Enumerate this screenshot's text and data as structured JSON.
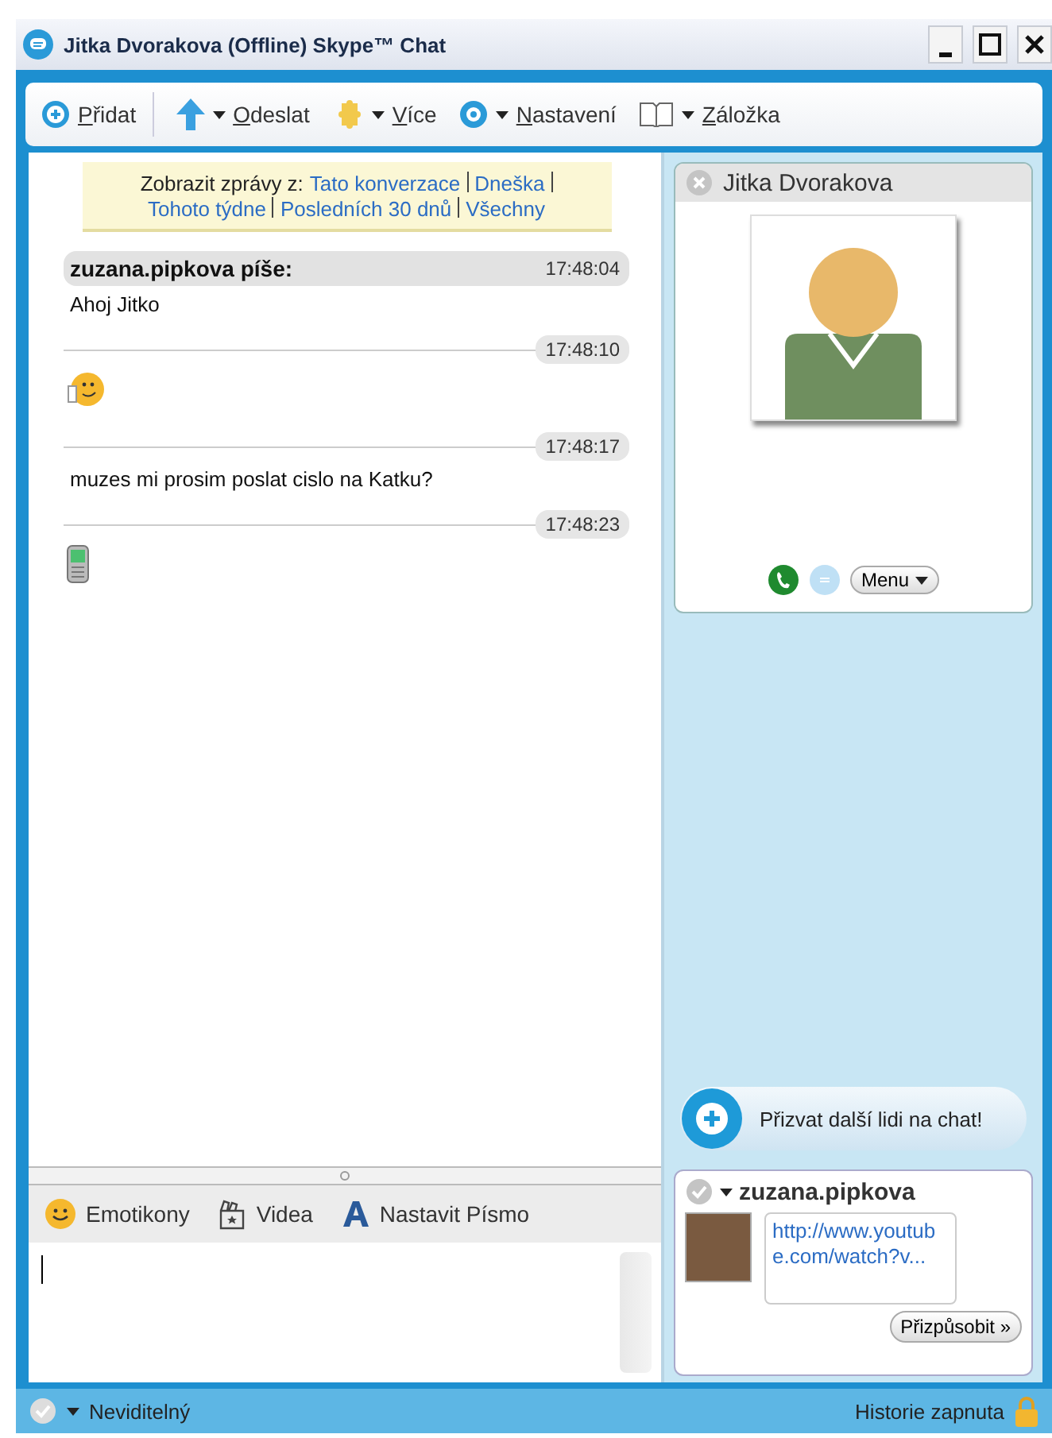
{
  "window": {
    "title": "Jitka Dvorakova (Offline) Skype™ Chat"
  },
  "toolbar": [
    {
      "kind": "add",
      "label": "Přidat"
    },
    {
      "kind": "send",
      "label": "Odeslat"
    },
    {
      "kind": "more",
      "label": "Více"
    },
    {
      "kind": "settings",
      "label": "Nastavení"
    },
    {
      "kind": "bookmark",
      "label": "Záložka"
    }
  ],
  "history_filter": {
    "label": "Zobrazit zprávy z:",
    "links": [
      "Tato konverzace",
      "Dneška",
      "Tohoto týdne",
      "Posledních 30 dnů",
      "Všechny"
    ]
  },
  "sender_header": {
    "name": "zuzana.pipkova píše:",
    "time": "17:48:04"
  },
  "messages": [
    {
      "kind": "text",
      "text": "Ahoj Jitko"
    },
    {
      "kind": "emoticon",
      "time": "17:48:10"
    },
    {
      "kind": "text",
      "time": "17:48:17",
      "text": "muzes mi prosim poslat cislo na Katku?"
    },
    {
      "kind": "phone",
      "time": "17:48:23"
    }
  ],
  "contact": {
    "name": "Jitka Dvorakova",
    "menu": "Menu"
  },
  "invite_button": "Přizvat další lidi na chat!",
  "mood": {
    "name": "zuzana.pipkova",
    "message": "http://www.youtube.com/watch?v...",
    "customize": "Přizpůsobit »"
  },
  "format_bar": [
    {
      "kind": "emoticons",
      "label": "Emotikony"
    },
    {
      "kind": "video",
      "label": "Videa"
    },
    {
      "kind": "font",
      "label": "Nastavit Písmo"
    }
  ],
  "status_bar": {
    "status": "Neviditelný",
    "history": "Historie zapnuta"
  }
}
